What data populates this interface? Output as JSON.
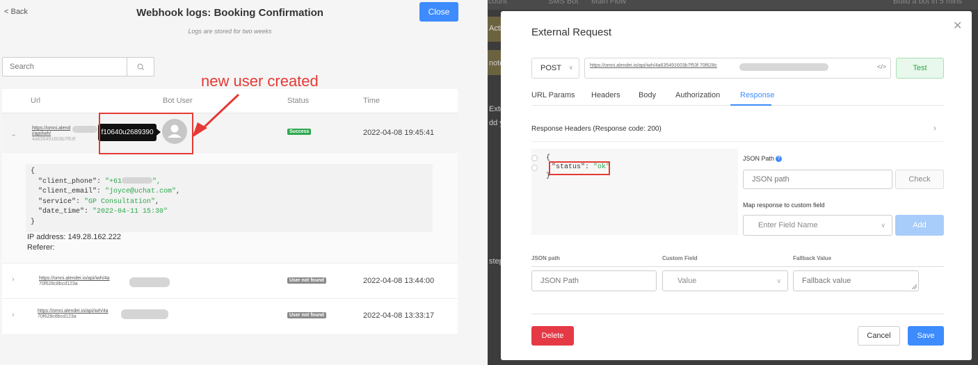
{
  "webhook": {
    "back_label": "< Back",
    "title": "Webhook logs: Booking Confirmation",
    "close_label": "Close",
    "subtitle": "Logs are stored for two weeks",
    "search_placeholder": "Search",
    "columns": [
      "Url",
      "Bot User",
      "Status",
      "Time"
    ],
    "rows": [
      {
        "url_line1": "https://omni.alend",
        "url_line2": "i/api/iwh/",
        "url_line3": "4a635491603b7f53f",
        "user_id": "f10640u2689390",
        "status": "Success",
        "status_color": "#2fa84f",
        "time": "2022-04-08 19:45:41",
        "expanded": true
      },
      {
        "url_line1": "https://omni.alendei.io/api/iwh/4a",
        "url_line2": "70f628c8bcd123a",
        "status": "User not found",
        "time": "2022-04-08 13:44:00"
      },
      {
        "url_line1": "https://omni.alendei.io/api/iwh/4a",
        "url_line2": "70f628c8bcd123a",
        "status": "User not found",
        "time": "2022-04-08 13:33:17"
      }
    ],
    "payload": {
      "open": "{",
      "client_phone_key": "\"client_phone\": ",
      "client_phone_val": "\"+61",
      "client_phone_end": "\",",
      "client_email_key": "\"client_email\": ",
      "client_email_val": "\"joyce@uchat.com\"",
      "service_key": "\"service\": ",
      "service_val": "\"GP Consultation\"",
      "date_time_key": "\"date_time\": ",
      "date_time_val": "\"2022-04-11 15:30\"",
      "close": "}",
      "comma": ","
    },
    "ip_address": "IP address: 149.28.162.222",
    "referer": "Referer:",
    "annotation": "new user created",
    "annotation_color": "#e53935"
  },
  "background": {
    "crumb1": "count",
    "crumb2": "SMS Bot",
    "crumb3": "Main Flow",
    "right_label": "Build a bot in 5 mins",
    "side1": "Acti",
    "side2": "note",
    "side3": "Exte",
    "side4": "dd y",
    "side5": "step"
  },
  "external_request": {
    "title": "External Request",
    "method": "POST",
    "url": "https://omni.alendei.io/api/iwh/4a635491603b7f53f 70f628c",
    "test_label": "Test",
    "tabs": [
      "URL Params",
      "Headers",
      "Body",
      "Authorization",
      "Response"
    ],
    "active_tab": "Response",
    "response_header": "Response Headers (Response code: 200)",
    "response_json": {
      "open": "{",
      "key": "\"status\": ",
      "val": "\"ok\"",
      "close": "}"
    },
    "json_path_label": "JSON Path",
    "json_path_placeholder": "JSON path",
    "check_label": "Check",
    "map_label": "Map response to custom field",
    "field_placeholder": "Enter Field Name",
    "add_label": "Add",
    "mapping_columns": [
      "JSON path",
      "Custom Field",
      "Fallback Value"
    ],
    "mapping_json_placeholder": "JSON Path",
    "mapping_value_placeholder": "Value",
    "mapping_fallback_placeholder": "Fallback value",
    "delete_label": "Delete",
    "cancel_label": "Cancel",
    "save_label": "Save"
  },
  "colors": {
    "primary": "#3d8bfd",
    "success": "#2fa84f",
    "danger": "#e53945",
    "highlight": "#e53935"
  }
}
